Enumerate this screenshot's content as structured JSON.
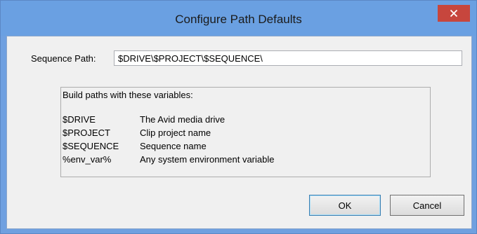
{
  "window": {
    "title": "Configure Path Defaults",
    "close_icon": "close-icon"
  },
  "sequence_path": {
    "label": "Sequence Path:",
    "value": "$DRIVE\\$PROJECT\\$SEQUENCE\\"
  },
  "variables": {
    "heading": "Build paths with these variables:",
    "items": [
      {
        "name": "$DRIVE",
        "description": "The Avid media drive"
      },
      {
        "name": "$PROJECT",
        "description": "Clip project name"
      },
      {
        "name": "$SEQUENCE",
        "description": "Sequence name"
      },
      {
        "name": "%env_var%",
        "description": "Any system environment variable"
      }
    ]
  },
  "buttons": {
    "ok_label": "OK",
    "cancel_label": "Cancel"
  },
  "colors": {
    "titlebar": "#6aa0e2",
    "close_button": "#c7463d",
    "client_background": "#f0f0f0"
  }
}
